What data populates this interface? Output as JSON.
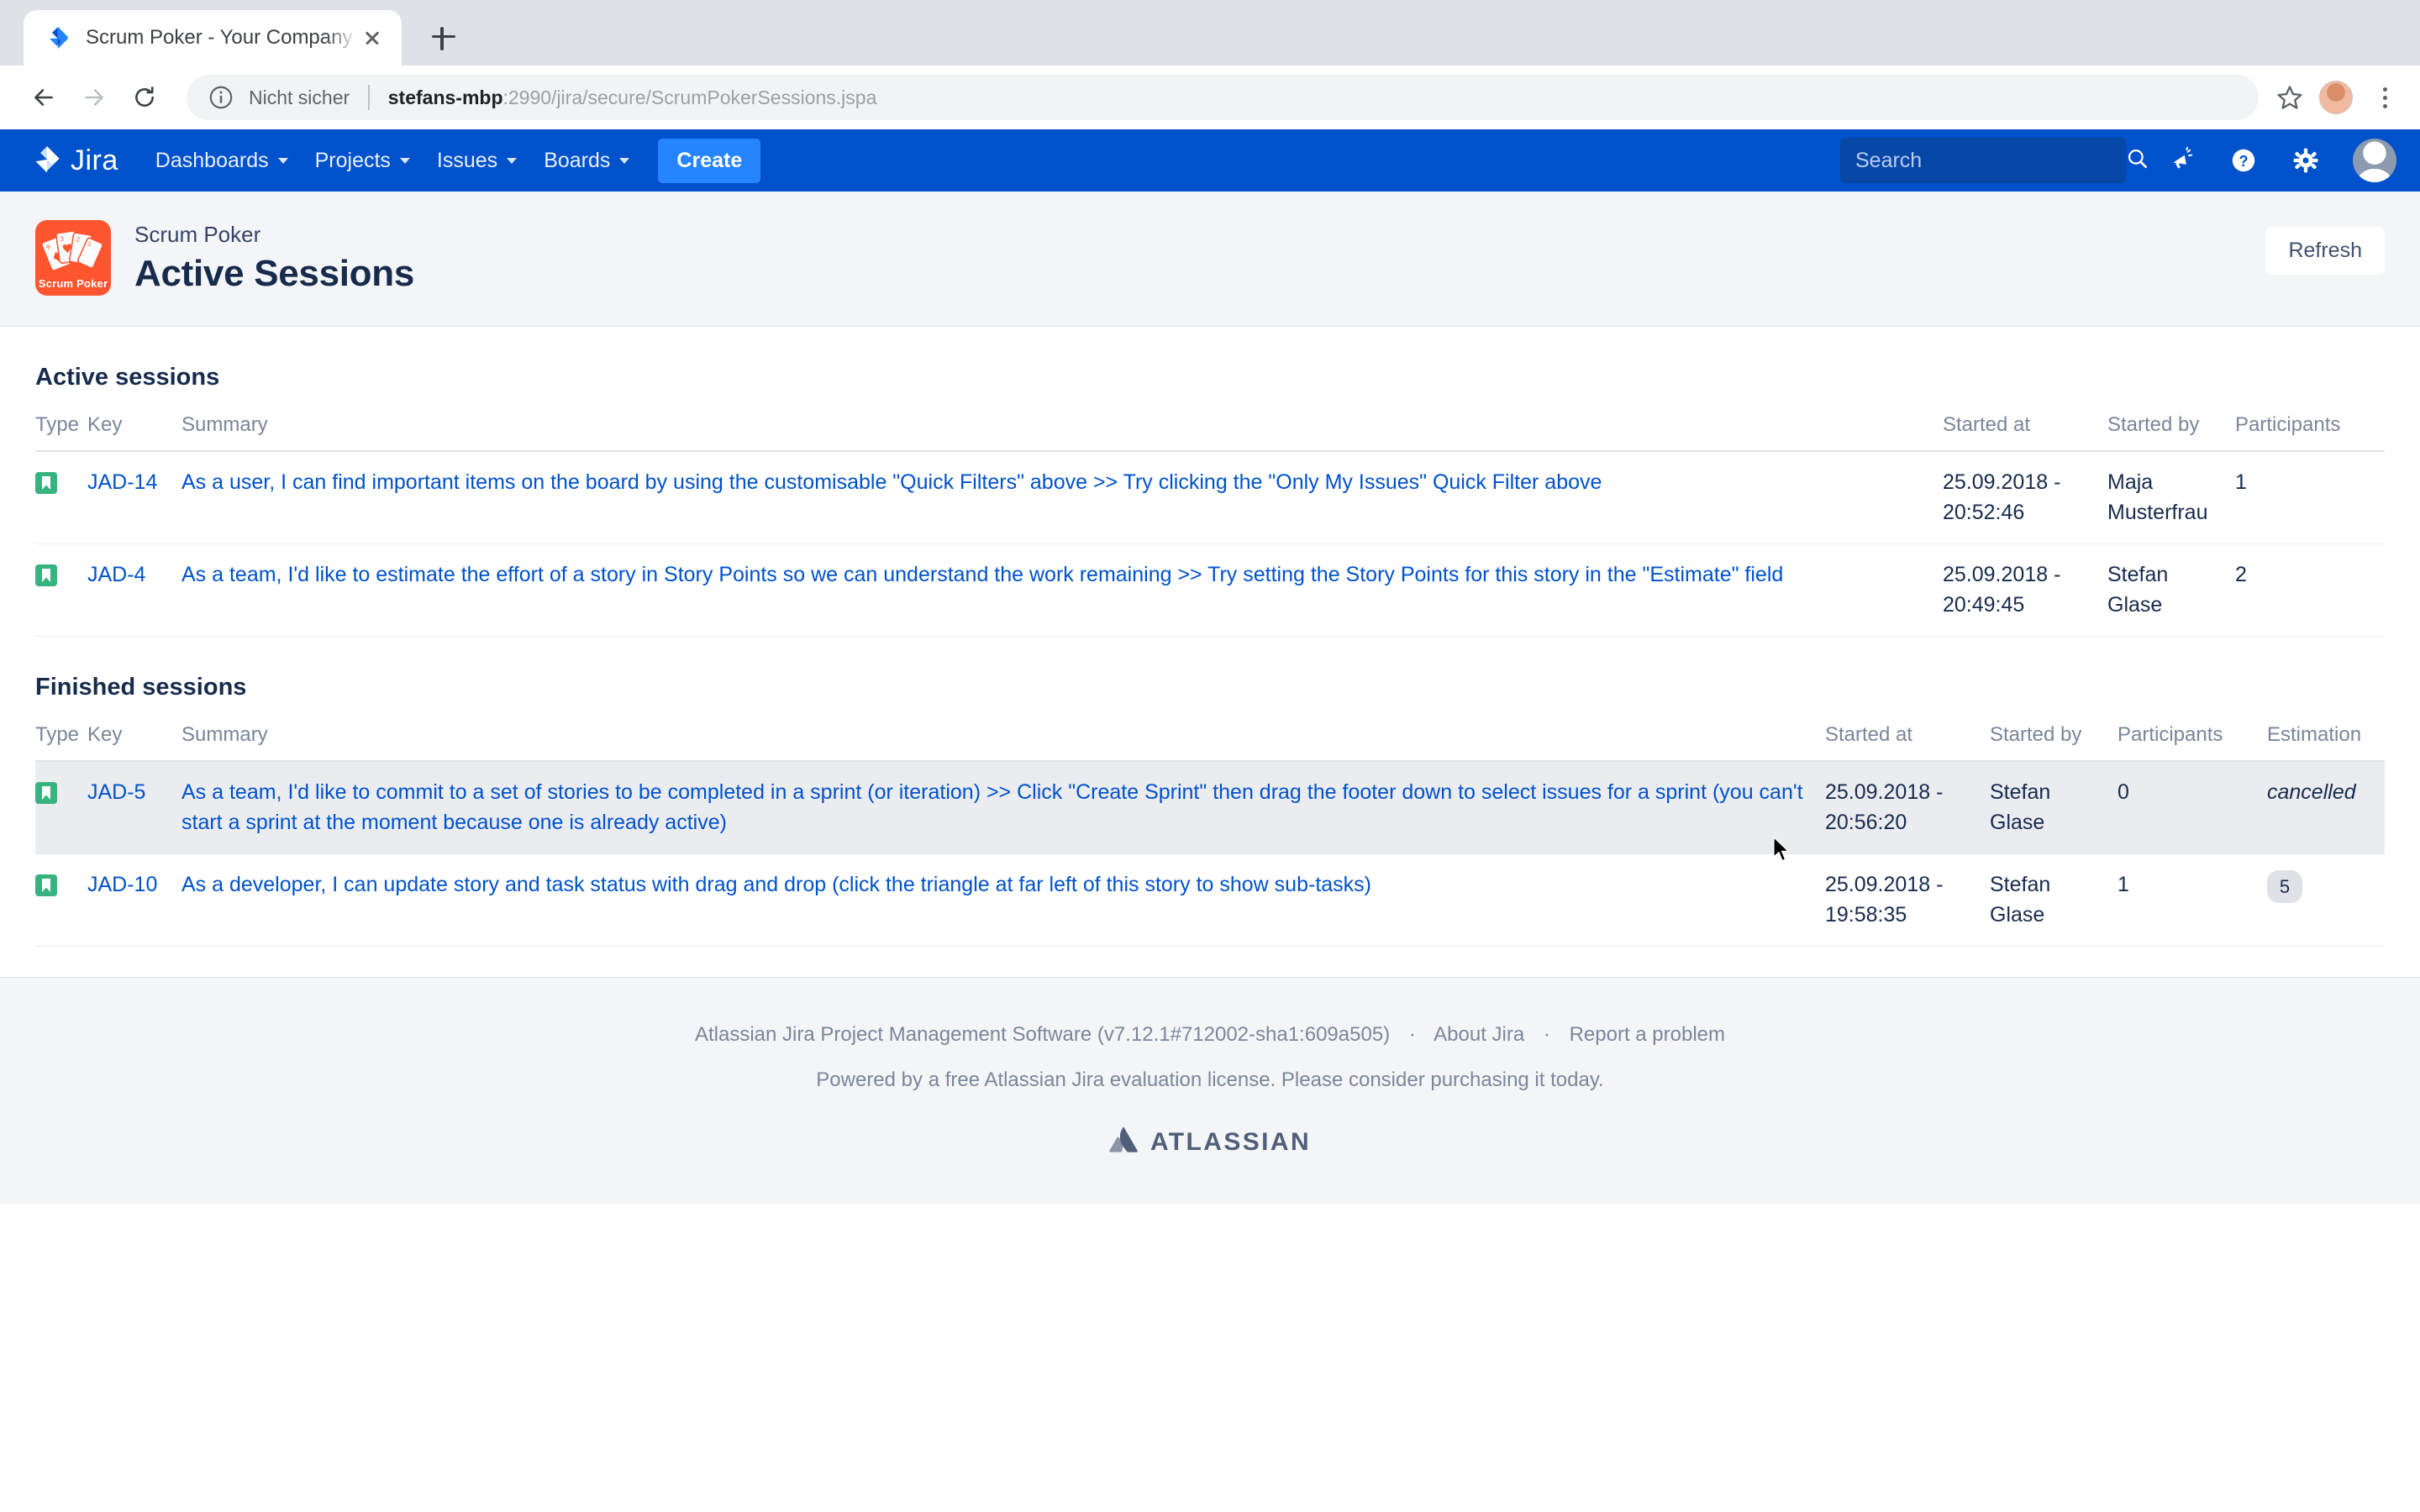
{
  "browser": {
    "tab": {
      "title": "Scrum Poker - Your Company J",
      "favicon_icon": "jira-favicon",
      "close_icon": "close-icon"
    },
    "new_tab_icon": "plus-icon",
    "back_icon": "back-arrow-icon",
    "forward_icon": "forward-arrow-icon",
    "reload_icon": "reload-icon",
    "security_icon": "info-circle-icon",
    "security_label": "Nicht sicher",
    "url_host": "stefans-mbp",
    "url_rest": ":2990/jira/secure/ScrumPokerSessions.jspa",
    "bookmark_icon": "star-icon",
    "profile_icon": "profile-avatar",
    "menu_icon": "three-dots-menu-icon"
  },
  "jira_nav": {
    "logo_text": "Jira",
    "logo_icon": "jira-logo-icon",
    "items": [
      {
        "label": "Dashboards",
        "has_caret": true
      },
      {
        "label": "Projects",
        "has_caret": true
      },
      {
        "label": "Issues",
        "has_caret": true
      },
      {
        "label": "Boards",
        "has_caret": true
      }
    ],
    "create_label": "Create",
    "search_placeholder": "Search",
    "search_value": "",
    "search_icon": "search-icon",
    "icons": [
      {
        "name": "megaphone-icon"
      },
      {
        "name": "help-question-icon"
      },
      {
        "name": "gear-settings-icon"
      },
      {
        "name": "user-avatar-icon"
      }
    ]
  },
  "page_header": {
    "app_logo_icon": "scrum-poker-logo",
    "app_logo_caption": "Scrum Poker",
    "subtitle": "Scrum Poker",
    "title": "Active Sessions",
    "refresh_label": "Refresh"
  },
  "active_sessions": {
    "heading": "Active sessions",
    "columns": [
      "Type",
      "Key",
      "Summary",
      "Started at",
      "Started by",
      "Participants"
    ],
    "rows": [
      {
        "type_icon": "story-issue-type-icon",
        "key": "JAD-14",
        "summary": "As a user, I can find important items on the board by using the customisable \"Quick Filters\" above >> Try clicking the \"Only My Issues\" Quick Filter above",
        "started_at": "25.09.2018 - 20:52:46",
        "started_by": "Maja Musterfrau",
        "participants": "1"
      },
      {
        "type_icon": "story-issue-type-icon",
        "key": "JAD-4",
        "summary": "As a team, I'd like to estimate the effort of a story in Story Points so we can understand the work remaining >> Try setting the Story Points for this story in the \"Estimate\" field",
        "started_at": "25.09.2018 - 20:49:45",
        "started_by": "Stefan Glase",
        "participants": "2"
      }
    ]
  },
  "finished_sessions": {
    "heading": "Finished sessions",
    "columns": [
      "Type",
      "Key",
      "Summary",
      "Started at",
      "Started by",
      "Participants",
      "Estimation"
    ],
    "rows": [
      {
        "type_icon": "story-issue-type-icon",
        "key": "JAD-5",
        "summary": "As a team, I'd like to commit to a set of stories to be completed in a sprint (or iteration) >> Click \"Create Sprint\" then drag the footer down to select issues for a sprint (you can't start a sprint at the moment because one is already active)",
        "started_at": "25.09.2018 - 20:56:20",
        "started_by": "Stefan Glase",
        "participants": "0",
        "estimation": "cancelled",
        "estimation_style": "cancelled",
        "highlighted": true
      },
      {
        "type_icon": "story-issue-type-icon",
        "key": "JAD-10",
        "summary": "As a developer, I can update story and task status with drag and drop (click the triangle at far left of this story to show sub-tasks)",
        "started_at": "25.09.2018 - 19:58:35",
        "started_by": "Stefan Glase",
        "participants": "1",
        "estimation": "5",
        "estimation_style": "badge",
        "highlighted": false
      }
    ]
  },
  "footer": {
    "product_line": "Atlassian Jira Project Management Software (v7.12.1#712002-sha1:609a505)",
    "dot": "·",
    "about_label": "About Jira",
    "report_label": "Report a problem",
    "license_line": "Powered by a free Atlassian Jira evaluation license. Please consider purchasing it today.",
    "atlassian_word": "ATLASSIAN",
    "atlassian_icon": "atlassian-logo-icon"
  }
}
